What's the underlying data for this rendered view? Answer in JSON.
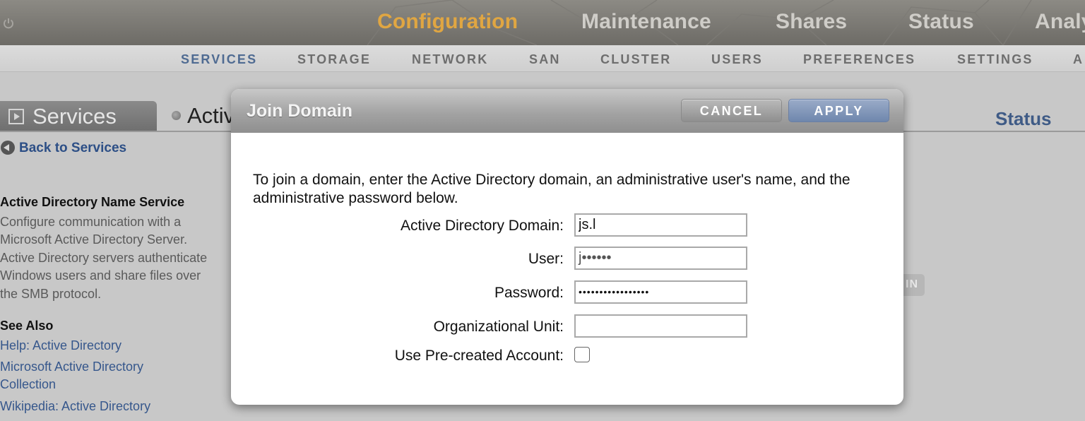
{
  "topnav": {
    "items": [
      "Configuration",
      "Maintenance",
      "Shares",
      "Status",
      "Analy"
    ],
    "active": "Configuration",
    "active_color": "#e0a642"
  },
  "subnav": {
    "items": [
      "SERVICES",
      "STORAGE",
      "NETWORK",
      "SAN",
      "CLUSTER",
      "USERS",
      "PREFERENCES",
      "SETTINGS",
      "A"
    ],
    "active": "SERVICES"
  },
  "page": {
    "tab_label": "Services",
    "title_partial": "Activ",
    "status_label": "Status",
    "back_link": "Back to Services",
    "ghost_button_partial": "IN"
  },
  "sidebar": {
    "heading": "Active Directory Name Service",
    "description": "Configure communication with a Microsoft Active Directory Server. Active Directory servers authenticate Windows users and share files over the SMB protocol.",
    "see_also_heading": "See Also",
    "links": [
      "Help: Active Directory",
      "Microsoft Active Directory Collection",
      "Wikipedia: Active Directory"
    ]
  },
  "dialog": {
    "title": "Join Domain",
    "cancel_label": "CANCEL",
    "apply_label": "APPLY",
    "intro": "To join a domain, enter the Active Directory domain, an administrative user's name, and the administrative password below.",
    "fields": {
      "domain": {
        "label": "Active Directory Domain:",
        "value": "js.l"
      },
      "user": {
        "label": "User:",
        "value": "j••••••"
      },
      "password": {
        "label": "Password:",
        "value": "•••••••••••••••••"
      },
      "ou": {
        "label": "Organizational Unit:",
        "value": ""
      },
      "precreated": {
        "label": "Use Pre-created Account:",
        "checked": false
      }
    }
  },
  "colors": {
    "accent_blue": "#3f5b86",
    "apply_button": "#7f95b9",
    "link": "#36578c"
  },
  "icons": [
    "power-icon",
    "play-icon",
    "back-arrow-icon",
    "status-dot-icon"
  ]
}
